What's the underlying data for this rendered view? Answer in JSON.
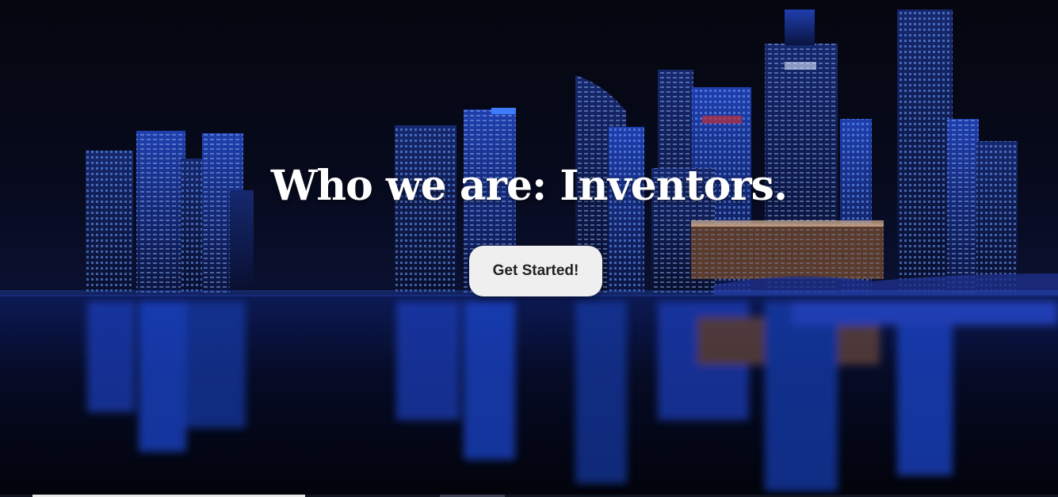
{
  "hero": {
    "headline": "Who we are: Inventors.",
    "cta_label": "Get Started!",
    "background_image": "night-city-skyline-reflection"
  },
  "colors": {
    "headline": "#ffffff",
    "button_bg": "#efefef",
    "button_text": "#222222",
    "city_glow": "#2b5cff"
  }
}
